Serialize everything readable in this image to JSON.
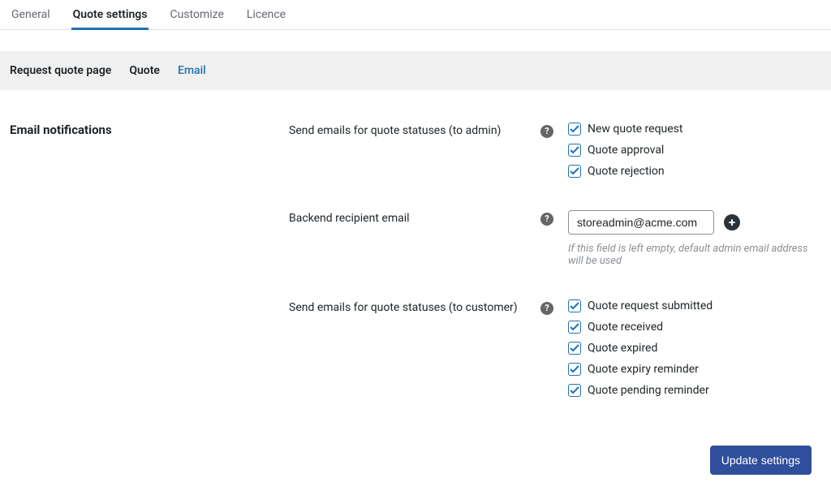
{
  "top_tabs": {
    "general": "General",
    "quote_settings": "Quote settings",
    "customize": "Customize",
    "licence": "Licence"
  },
  "sub_tabs": {
    "request_quote_page": "Request quote page",
    "quote": "Quote",
    "email": "Email"
  },
  "section_title": "Email notifications",
  "rows": {
    "admin_statuses": {
      "label": "Send emails for quote statuses (to admin)",
      "options": {
        "new_request": {
          "label": "New quote request",
          "checked": true
        },
        "approval": {
          "label": "Quote approval",
          "checked": true
        },
        "rejection": {
          "label": "Quote rejection",
          "checked": true
        }
      }
    },
    "backend_email": {
      "label": "Backend recipient email",
      "value": "storeadmin@acme.com",
      "hint": "If this field is left empty, default admin email address will be used"
    },
    "customer_statuses": {
      "label": "Send emails for quote statuses (to customer)",
      "options": {
        "submitted": {
          "label": "Quote request submitted",
          "checked": true
        },
        "received": {
          "label": "Quote received",
          "checked": true
        },
        "expired": {
          "label": "Quote expired",
          "checked": true
        },
        "expiry_reminder": {
          "label": "Quote expiry reminder",
          "checked": true
        },
        "pending_reminder": {
          "label": "Quote pending reminder",
          "checked": true
        }
      }
    }
  },
  "buttons": {
    "update": "Update settings"
  },
  "icons": {
    "help": "?",
    "plus": "+"
  }
}
